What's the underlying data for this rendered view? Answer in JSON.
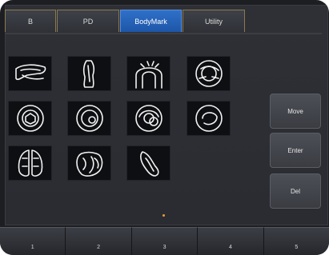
{
  "tabs": [
    {
      "label": "B",
      "active": false
    },
    {
      "label": "PD",
      "active": false
    },
    {
      "label": "BodyMark",
      "active": true
    },
    {
      "label": "Utility",
      "active": false
    }
  ],
  "bodymarks": [
    {
      "icon": "breast-side-icon"
    },
    {
      "icon": "arm-icon"
    },
    {
      "icon": "hip-joint-icon"
    },
    {
      "icon": "head-top-icon"
    },
    {
      "icon": "breast-left-icon"
    },
    {
      "icon": "breast-right-icon"
    },
    {
      "icon": "eye-left-icon"
    },
    {
      "icon": "eye-right-icon"
    },
    {
      "icon": "kidney-pair-icon"
    },
    {
      "icon": "heart-icon"
    },
    {
      "icon": "foot-icon"
    }
  ],
  "side_buttons": {
    "move": "Move",
    "enter": "Enter",
    "del": "Del"
  },
  "softkeys": [
    "1",
    "2",
    "3",
    "4",
    "5"
  ],
  "colors": {
    "active_tab": "#2f70c8",
    "tab_border": "#8a7a52",
    "page_indicator": "#e8a030",
    "icon_stroke": "#f2f2f2"
  }
}
